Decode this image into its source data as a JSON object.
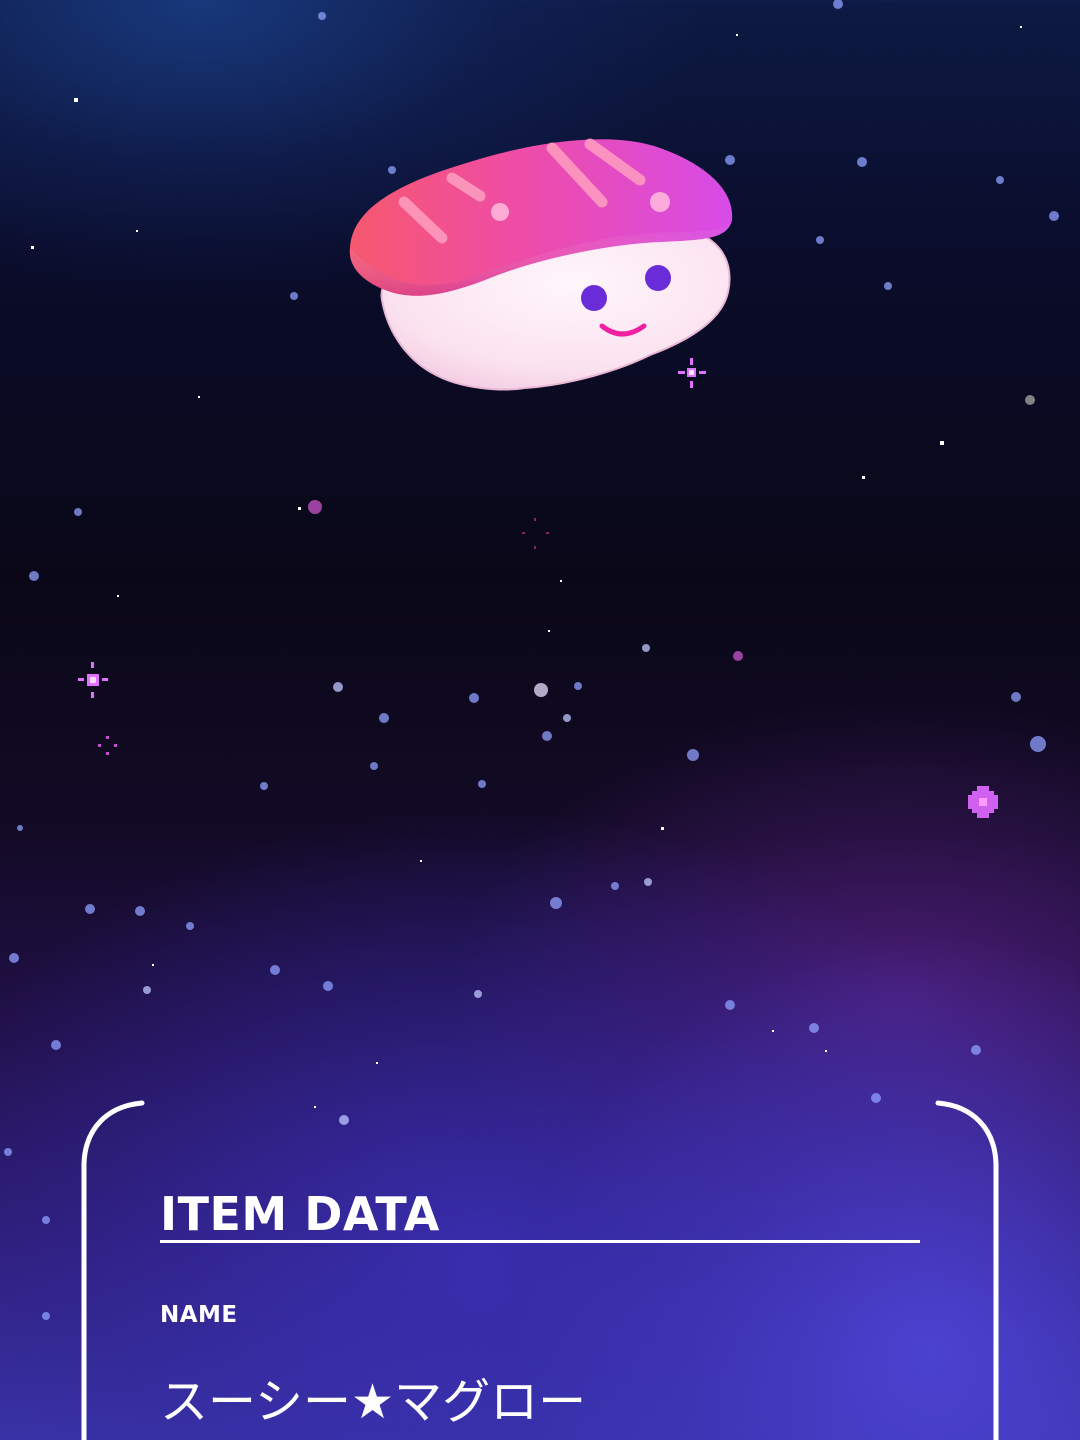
{
  "item_panel": {
    "title": "ITEM DATA",
    "fields": [
      {
        "label": "NAME",
        "value": "スーシー★マグロー"
      }
    ]
  },
  "colors": {
    "panel_border": "#ffffff",
    "sushi_topping_pink": "#f0508a",
    "sushi_topping_magenta": "#d048e0",
    "sushi_rice": "#fde8f2",
    "sushi_eyes": "#6a2bd8",
    "sushi_mouth": "#f020a0",
    "sparkle": "#e070ff"
  },
  "icons": {
    "mascot": "sushi-maguro-character",
    "decorations": [
      "sparkle-icon",
      "star-field"
    ]
  }
}
